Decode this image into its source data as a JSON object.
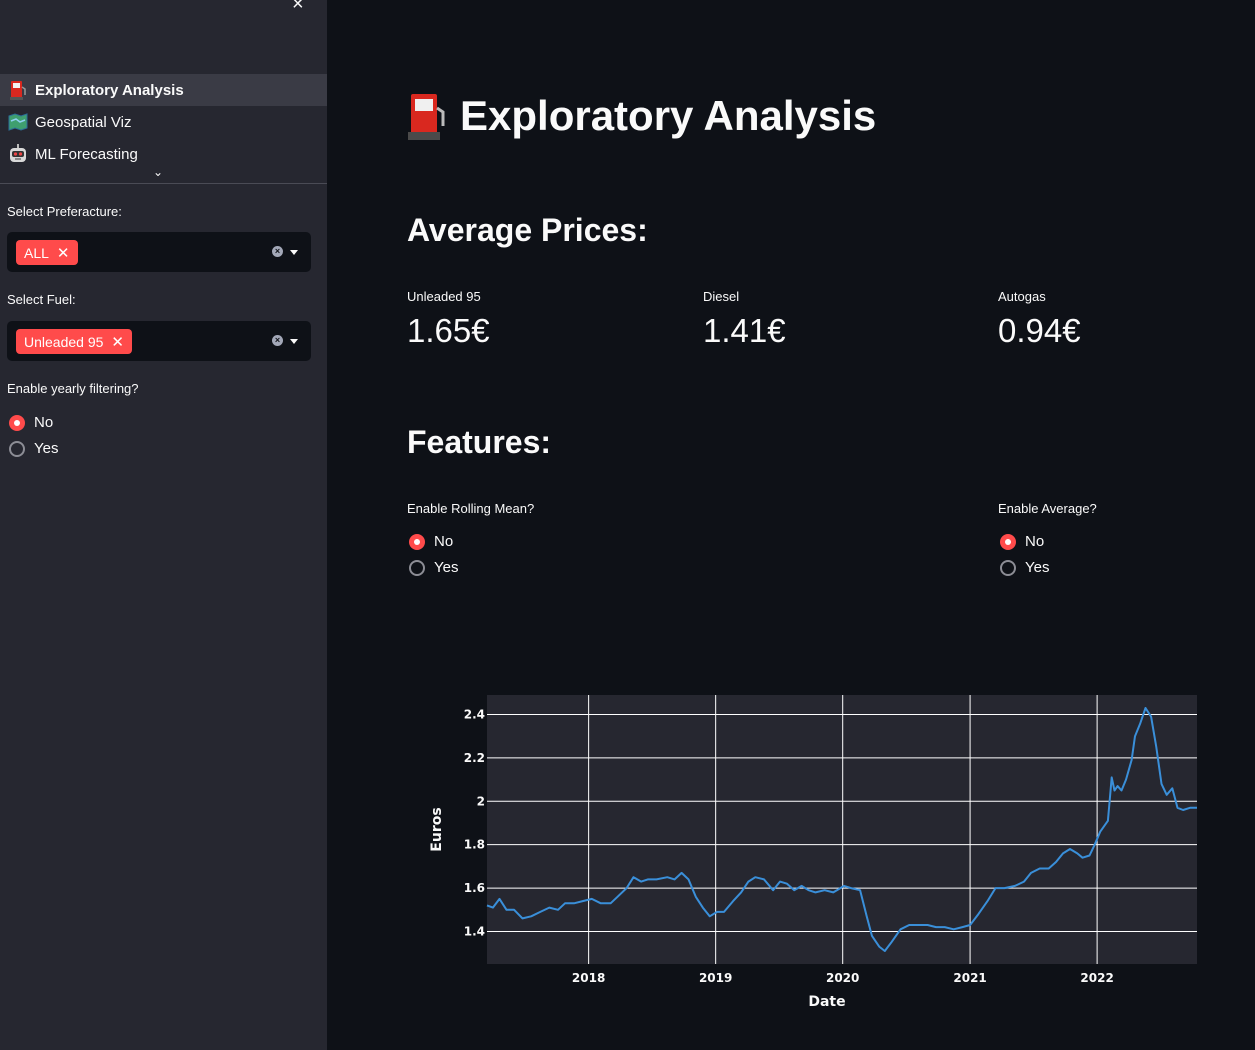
{
  "sidebar": {
    "close_glyph": "×",
    "nav": [
      {
        "label": "Exploratory Analysis",
        "icon": "fuel-pump-icon",
        "active": true
      },
      {
        "label": "Geospatial Viz",
        "icon": "map-icon",
        "active": false
      },
      {
        "label": "ML Forecasting",
        "icon": "robot-icon",
        "active": false
      }
    ],
    "expand_glyph": "⌄",
    "prefecture_label": "Select Preferacture:",
    "prefecture_tag": "ALL",
    "fuel_label": "Select Fuel:",
    "fuel_tag": "Unleaded 95",
    "tag_remove": "✕",
    "yearly_label": "Enable yearly filtering?",
    "yearly_options": [
      "No",
      "Yes"
    ],
    "yearly_selected": "No"
  },
  "main": {
    "title": "Exploratory Analysis",
    "title_icon": "fuel-pump-icon",
    "avg_heading": "Average Prices:",
    "metrics": [
      {
        "label": "Unleaded 95",
        "value": "1.65€"
      },
      {
        "label": "Diesel",
        "value": "1.41€"
      },
      {
        "label": "Autogas",
        "value": "0.94€"
      }
    ],
    "features_heading": "Features:",
    "rolling_label": "Enable Rolling Mean?",
    "rolling_options": [
      "No",
      "Yes"
    ],
    "rolling_selected": "No",
    "average_label": "Enable Average?",
    "average_options": [
      "No",
      "Yes"
    ],
    "average_selected": "No"
  },
  "colors": {
    "accent": "#ff4b4b",
    "line": "#3a8fd9",
    "plot_bg": "#262730",
    "app_bg": "#0e1117",
    "sidebar_bg": "#262730"
  },
  "chart_data": {
    "type": "line",
    "xlabel": "Date",
    "ylabel": "Euros",
    "x_ticks": [
      "2018",
      "2019",
      "2020",
      "2021",
      "2022"
    ],
    "y_ticks": [
      "1.4",
      "1.6",
      "1.8",
      "2",
      "2.2",
      "2.4"
    ],
    "ylim": [
      1.25,
      2.49
    ],
    "xlim": [
      "2017-03-15",
      "2022-10-15"
    ],
    "grid": true,
    "series": [
      {
        "points": [
          [
            "2017-03-15",
            1.52
          ],
          [
            "2017-04-01",
            1.51
          ],
          [
            "2017-04-20",
            1.55
          ],
          [
            "2017-05-10",
            1.5
          ],
          [
            "2017-06-01",
            1.5
          ],
          [
            "2017-06-25",
            1.46
          ],
          [
            "2017-07-20",
            1.47
          ],
          [
            "2017-08-15",
            1.49
          ],
          [
            "2017-09-10",
            1.51
          ],
          [
            "2017-10-05",
            1.5
          ],
          [
            "2017-10-25",
            1.53
          ],
          [
            "2017-11-20",
            1.53
          ],
          [
            "2017-12-15",
            1.54
          ],
          [
            "2018-01-10",
            1.55
          ],
          [
            "2018-02-05",
            1.53
          ],
          [
            "2018-03-05",
            1.53
          ],
          [
            "2018-03-25",
            1.56
          ],
          [
            "2018-04-20",
            1.6
          ],
          [
            "2018-05-10",
            1.65
          ],
          [
            "2018-06-01",
            1.63
          ],
          [
            "2018-06-20",
            1.64
          ],
          [
            "2018-07-15",
            1.64
          ],
          [
            "2018-08-15",
            1.65
          ],
          [
            "2018-09-05",
            1.64
          ],
          [
            "2018-09-25",
            1.67
          ],
          [
            "2018-10-15",
            1.64
          ],
          [
            "2018-11-05",
            1.56
          ],
          [
            "2018-11-25",
            1.51
          ],
          [
            "2018-12-15",
            1.47
          ],
          [
            "2019-01-05",
            1.49
          ],
          [
            "2019-01-25",
            1.49
          ],
          [
            "2019-02-20",
            1.54
          ],
          [
            "2019-03-15",
            1.58
          ],
          [
            "2019-04-05",
            1.63
          ],
          [
            "2019-04-25",
            1.65
          ],
          [
            "2019-05-20",
            1.64
          ],
          [
            "2019-06-15",
            1.59
          ],
          [
            "2019-07-05",
            1.63
          ],
          [
            "2019-07-25",
            1.62
          ],
          [
            "2019-08-15",
            1.59
          ],
          [
            "2019-09-05",
            1.61
          ],
          [
            "2019-09-25",
            1.59
          ],
          [
            "2019-10-15",
            1.58
          ],
          [
            "2019-11-10",
            1.59
          ],
          [
            "2019-12-05",
            1.58
          ],
          [
            "2020-01-05",
            1.61
          ],
          [
            "2020-01-25",
            1.6
          ],
          [
            "2020-02-20",
            1.59
          ],
          [
            "2020-03-10",
            1.47
          ],
          [
            "2020-03-25",
            1.38
          ],
          [
            "2020-04-15",
            1.33
          ],
          [
            "2020-05-01",
            1.31
          ],
          [
            "2020-05-20",
            1.35
          ],
          [
            "2020-06-15",
            1.41
          ],
          [
            "2020-07-10",
            1.43
          ],
          [
            "2020-08-05",
            1.43
          ],
          [
            "2020-09-01",
            1.43
          ],
          [
            "2020-09-25",
            1.42
          ],
          [
            "2020-10-20",
            1.42
          ],
          [
            "2020-11-15",
            1.41
          ],
          [
            "2020-12-10",
            1.42
          ],
          [
            "2021-01-01",
            1.43
          ],
          [
            "2021-01-25",
            1.48
          ],
          [
            "2021-02-20",
            1.54
          ],
          [
            "2021-03-15",
            1.6
          ],
          [
            "2021-04-10",
            1.6
          ],
          [
            "2021-05-10",
            1.61
          ],
          [
            "2021-06-05",
            1.63
          ],
          [
            "2021-06-25",
            1.67
          ],
          [
            "2021-07-20",
            1.69
          ],
          [
            "2021-08-15",
            1.69
          ],
          [
            "2021-09-05",
            1.72
          ],
          [
            "2021-09-25",
            1.76
          ],
          [
            "2021-10-15",
            1.78
          ],
          [
            "2021-11-05",
            1.76
          ],
          [
            "2021-11-20",
            1.74
          ],
          [
            "2021-12-10",
            1.75
          ],
          [
            "2021-12-25",
            1.8
          ],
          [
            "2022-01-10",
            1.86
          ],
          [
            "2022-02-01",
            1.91
          ],
          [
            "2022-02-12",
            2.11
          ],
          [
            "2022-02-20",
            2.05
          ],
          [
            "2022-03-01",
            2.07
          ],
          [
            "2022-03-12",
            2.05
          ],
          [
            "2022-03-25",
            2.1
          ],
          [
            "2022-04-10",
            2.19
          ],
          [
            "2022-04-20",
            2.3
          ],
          [
            "2022-05-05",
            2.36
          ],
          [
            "2022-05-20",
            2.43
          ],
          [
            "2022-06-05",
            2.39
          ],
          [
            "2022-06-20",
            2.25
          ],
          [
            "2022-07-05",
            2.08
          ],
          [
            "2022-07-20",
            2.03
          ],
          [
            "2022-08-05",
            2.06
          ],
          [
            "2022-08-20",
            1.97
          ],
          [
            "2022-09-05",
            1.96
          ],
          [
            "2022-09-25",
            1.97
          ],
          [
            "2022-10-15",
            1.97
          ]
        ]
      }
    ]
  }
}
